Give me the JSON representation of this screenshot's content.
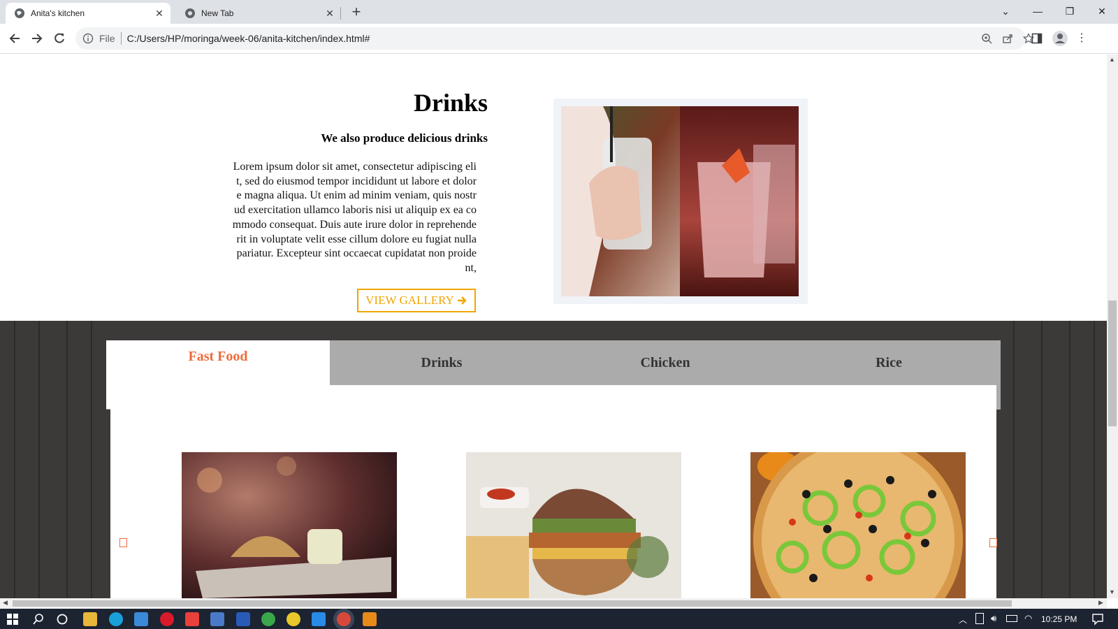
{
  "browser": {
    "tabs": [
      {
        "title": "Anita's kitchen",
        "active": true
      },
      {
        "title": "New Tab",
        "active": false
      }
    ],
    "new_tab_symbol": "+",
    "address": {
      "scheme_label": "File",
      "url": "C:/Users/HP/moringa/week-06/anita-kitchen/index.html#"
    }
  },
  "drinks": {
    "title": "Drinks",
    "subtitle": "We also produce delicious drinks",
    "body": "Lorem ipsum dolor sit amet, consectetur adipiscing elit, sed do eiusmod tempor incididunt ut labore et dolore magna aliqua. Ut enim ad minim veniam, quis nostrud exercitation ullamco laboris nisi ut aliquip ex ea commodo consequat. Duis aute irure dolor in reprehenderit in voluptate velit esse cillum dolore eu fugiat nulla pariatur. Excepteur sint occaecat cupidatat non proident,",
    "button": "VIEW GALLERY"
  },
  "menu": {
    "tabs": [
      {
        "label": "Fast Food",
        "active": true
      },
      {
        "label": "Drinks",
        "active": false
      },
      {
        "label": "Chicken",
        "active": false
      },
      {
        "label": "Rice",
        "active": false
      }
    ],
    "accent_color": "#ee6c3b"
  },
  "taskbar": {
    "time": "10:25 PM"
  },
  "colors": {
    "button_accent": "#f0a500",
    "tab_inactive_bg": "#ababab",
    "wood_bg": "#3c3a39"
  }
}
